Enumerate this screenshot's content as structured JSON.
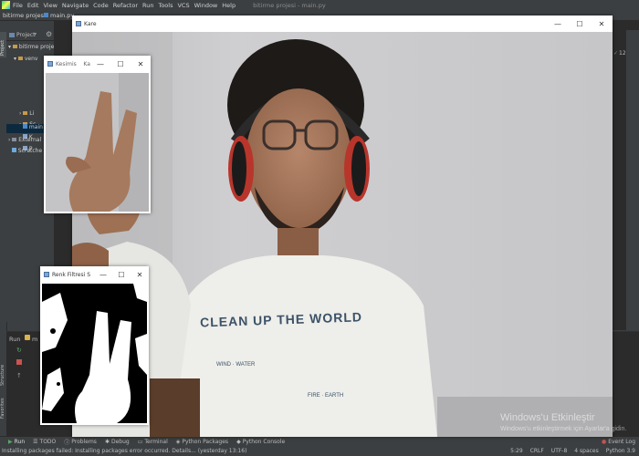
{
  "ide": {
    "menu": [
      "File",
      "Edit",
      "View",
      "Navigate",
      "Code",
      "Refactor",
      "Run",
      "Tools",
      "VCS",
      "Window",
      "Help"
    ],
    "window_title": "bitirme projesi - main.py",
    "breadcrumb_project": "bitirme projesi",
    "breadcrumb_file": "main.py",
    "project_panel_label": "Project",
    "tree": [
      {
        "label": "bitirme projesi",
        "indent": 0
      },
      {
        "label": "venv",
        "indent": 1
      },
      {
        "label": "Li",
        "indent": 2
      },
      {
        "label": "Sc",
        "indent": 2
      },
      {
        "label": "K",
        "indent": 2
      },
      {
        "label": "P",
        "indent": 2
      },
      {
        "label": "main",
        "indent": 1,
        "selected": true
      },
      {
        "label": "External",
        "indent": 0
      },
      {
        "label": "Scratche",
        "indent": 0
      }
    ],
    "run_label": "Run",
    "run_config": "m",
    "inspection_count": "12",
    "side_tabs_left": [
      "Project",
      "Structure",
      "Favorites"
    ],
    "bottom_tabs": [
      "Run",
      "TODO",
      "Problems",
      "Debug",
      "Terminal",
      "Python Packages",
      "Python Console"
    ],
    "event_log": "Event Log",
    "status_message": "Installing packages failed: Installing packages error occurred. Details... (yesterday 13:16)",
    "status_right": [
      "5:29",
      "CRLF",
      "UTF-8",
      "4 spaces",
      "Python 3.9"
    ]
  },
  "windows": {
    "kare": {
      "title": "Kare"
    },
    "kesimis": {
      "title": "Kesimis    Ka"
    },
    "renk": {
      "title": "Renk Filtresi S"
    },
    "controls": {
      "minimize": "—",
      "maximize": "☐",
      "close": "✕"
    }
  },
  "windows_activation": {
    "line1": "Windows'u Etkinleştir",
    "line2": "Windows'u etkinleştirmek için Ayarlar'a gidin."
  },
  "shirt_text": {
    "line1": "CLEAN UP THE WORLD",
    "line2": "WIND · WATER",
    "line3": "FIRE · EARTH"
  },
  "colors": {
    "ide_bg": "#3c3f41",
    "editor_bg": "#2b2b2b",
    "accent_green": "#59a869",
    "error_red": "#c75450"
  }
}
